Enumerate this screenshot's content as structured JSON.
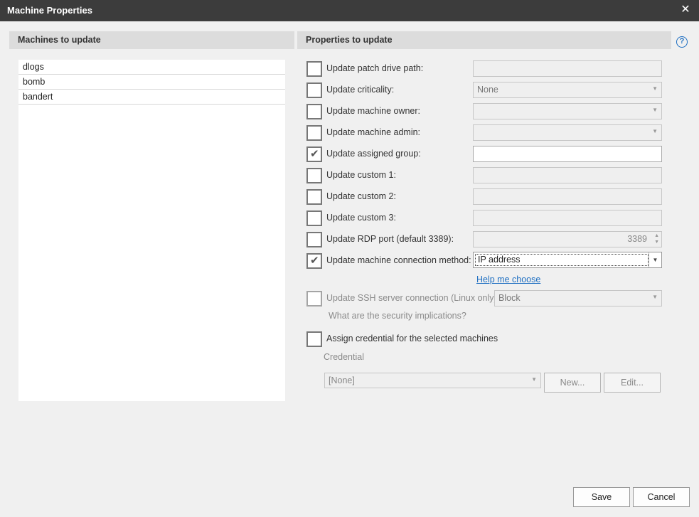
{
  "window": {
    "title": "Machine Properties",
    "close_glyph": "✕"
  },
  "left_panel": {
    "header": "Machines to update",
    "machines": [
      "dlogs",
      "bomb",
      "bandert"
    ]
  },
  "right_panel": {
    "header": "Properties to update",
    "help_glyph": "?",
    "properties": [
      {
        "label": "Update patch drive path:",
        "checked": false,
        "value": ""
      },
      {
        "label": "Update criticality:",
        "checked": false,
        "value": "None"
      },
      {
        "label": "Update machine owner:",
        "checked": false,
        "value": ""
      },
      {
        "label": "Update machine admin:",
        "checked": false,
        "value": ""
      },
      {
        "label": "Update assigned group:",
        "checked": true,
        "value": ""
      },
      {
        "label": "Update custom 1:",
        "checked": false,
        "value": ""
      },
      {
        "label": "Update custom 2:",
        "checked": false,
        "value": ""
      },
      {
        "label": "Update custom 3:",
        "checked": false,
        "value": ""
      },
      {
        "label": "Update RDP port (default 3389):",
        "checked": false,
        "value": "3389"
      },
      {
        "label": "Update machine connection method:",
        "checked": true,
        "value": "IP address"
      }
    ],
    "help_link": "Help me choose",
    "ssh": {
      "label": "Update SSH server connection (Linux only):",
      "checked": false,
      "value": "Block",
      "note": "What are the security implications?"
    },
    "credential": {
      "label": "Assign credential for the selected machines",
      "checked": false,
      "caption": "Credential",
      "value": "[None]",
      "new_label": "New...",
      "edit_label": "Edit..."
    }
  },
  "footer": {
    "save_label": "Save",
    "cancel_label": "Cancel"
  },
  "icons": {
    "check": "✔",
    "dropdown": "▼",
    "spin_up": "▲",
    "spin_down": "▼"
  }
}
